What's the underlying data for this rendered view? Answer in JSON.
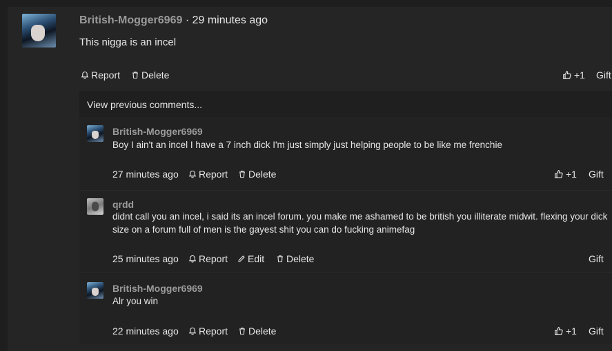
{
  "post": {
    "author": "British-Mogger6969",
    "separator": "·",
    "time": "29 minutes ago",
    "text": "This nigga is an incel",
    "actions": {
      "report": "Report",
      "delete": "Delete",
      "plus_one": "+1",
      "gift": "Gift"
    }
  },
  "thread": {
    "view_previous": "View previous comments...",
    "comments": [
      {
        "author": "British-Mogger6969",
        "text": "Boy I ain't an incel I have a 7 inch dick I'm just simply just helping people to be like me frenchie",
        "time": "27 minutes ago",
        "report": "Report",
        "delete": "Delete",
        "plus_one": "+1",
        "gift": "Gift"
      },
      {
        "author": "qrdd",
        "text_line1": "didnt call you an incel, i said its an incel forum. you make me ashamed to be british you illiterate midwit. flexing your dick",
        "text_line2": "size on a forum full of men is the gayest shit you can do fucking animefag",
        "time": "25 minutes ago",
        "report": "Report",
        "edit": "Edit",
        "delete": "Delete",
        "gift": "Gift"
      },
      {
        "author": "British-Mogger6969",
        "text": "Alr you win",
        "time": "22 minutes ago",
        "report": "Report",
        "delete": "Delete",
        "plus_one": "+1",
        "gift": "Gift"
      }
    ]
  },
  "colors": {
    "background": "#1e1e1e",
    "panel": "#252525",
    "author": "#9a9a9a",
    "text": "#e6e6e6"
  },
  "icons": [
    "bell-icon",
    "trash-icon",
    "thumbs-up-icon",
    "pencil-icon"
  ]
}
